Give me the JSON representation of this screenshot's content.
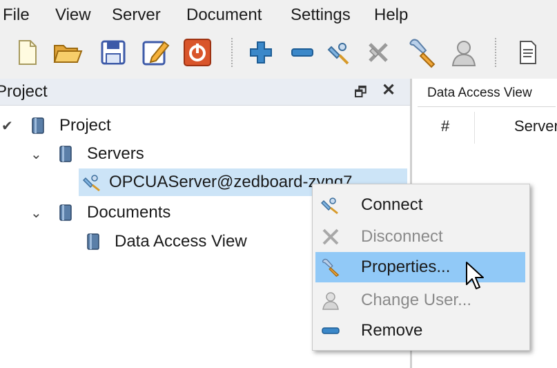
{
  "menubar": {
    "items": [
      "File",
      "View",
      "Server",
      "Document",
      "Settings",
      "Help"
    ]
  },
  "toolbar": {
    "buttons": [
      "new-document-icon",
      "open-folder-icon",
      "save-icon",
      "edit-document-icon",
      "power-icon",
      "add-icon",
      "remove-icon",
      "connect-icon",
      "disconnect-icon",
      "properties-icon",
      "user-icon",
      "document-view-icon"
    ]
  },
  "project_panel": {
    "title": "Project",
    "float_glyph": "🗗",
    "close_glyph": "✕",
    "tree": {
      "root": "Project",
      "servers": "Servers",
      "server_item": "OPCUAServer@zedboard-zynq7",
      "documents": "Documents",
      "document_item": "Data Access View"
    }
  },
  "data_access_view": {
    "tab_label": "Data Access View",
    "columns": [
      "#",
      "Server"
    ]
  },
  "context_menu": {
    "items": [
      {
        "label": "Connect",
        "icon": "connect-icon",
        "enabled": true
      },
      {
        "label": "Disconnect",
        "icon": "disconnect-icon",
        "enabled": false
      },
      {
        "label": "Properties...",
        "icon": "wrench-icon",
        "enabled": true,
        "highlighted": true
      },
      {
        "label": "Change User...",
        "icon": "user-icon",
        "enabled": false
      },
      {
        "label": "Remove",
        "icon": "remove-icon",
        "enabled": true
      }
    ]
  },
  "colors": {
    "selection": "#cce4f7",
    "menu_highlight": "#91c9f7",
    "panel_header": "#e9edf3"
  }
}
